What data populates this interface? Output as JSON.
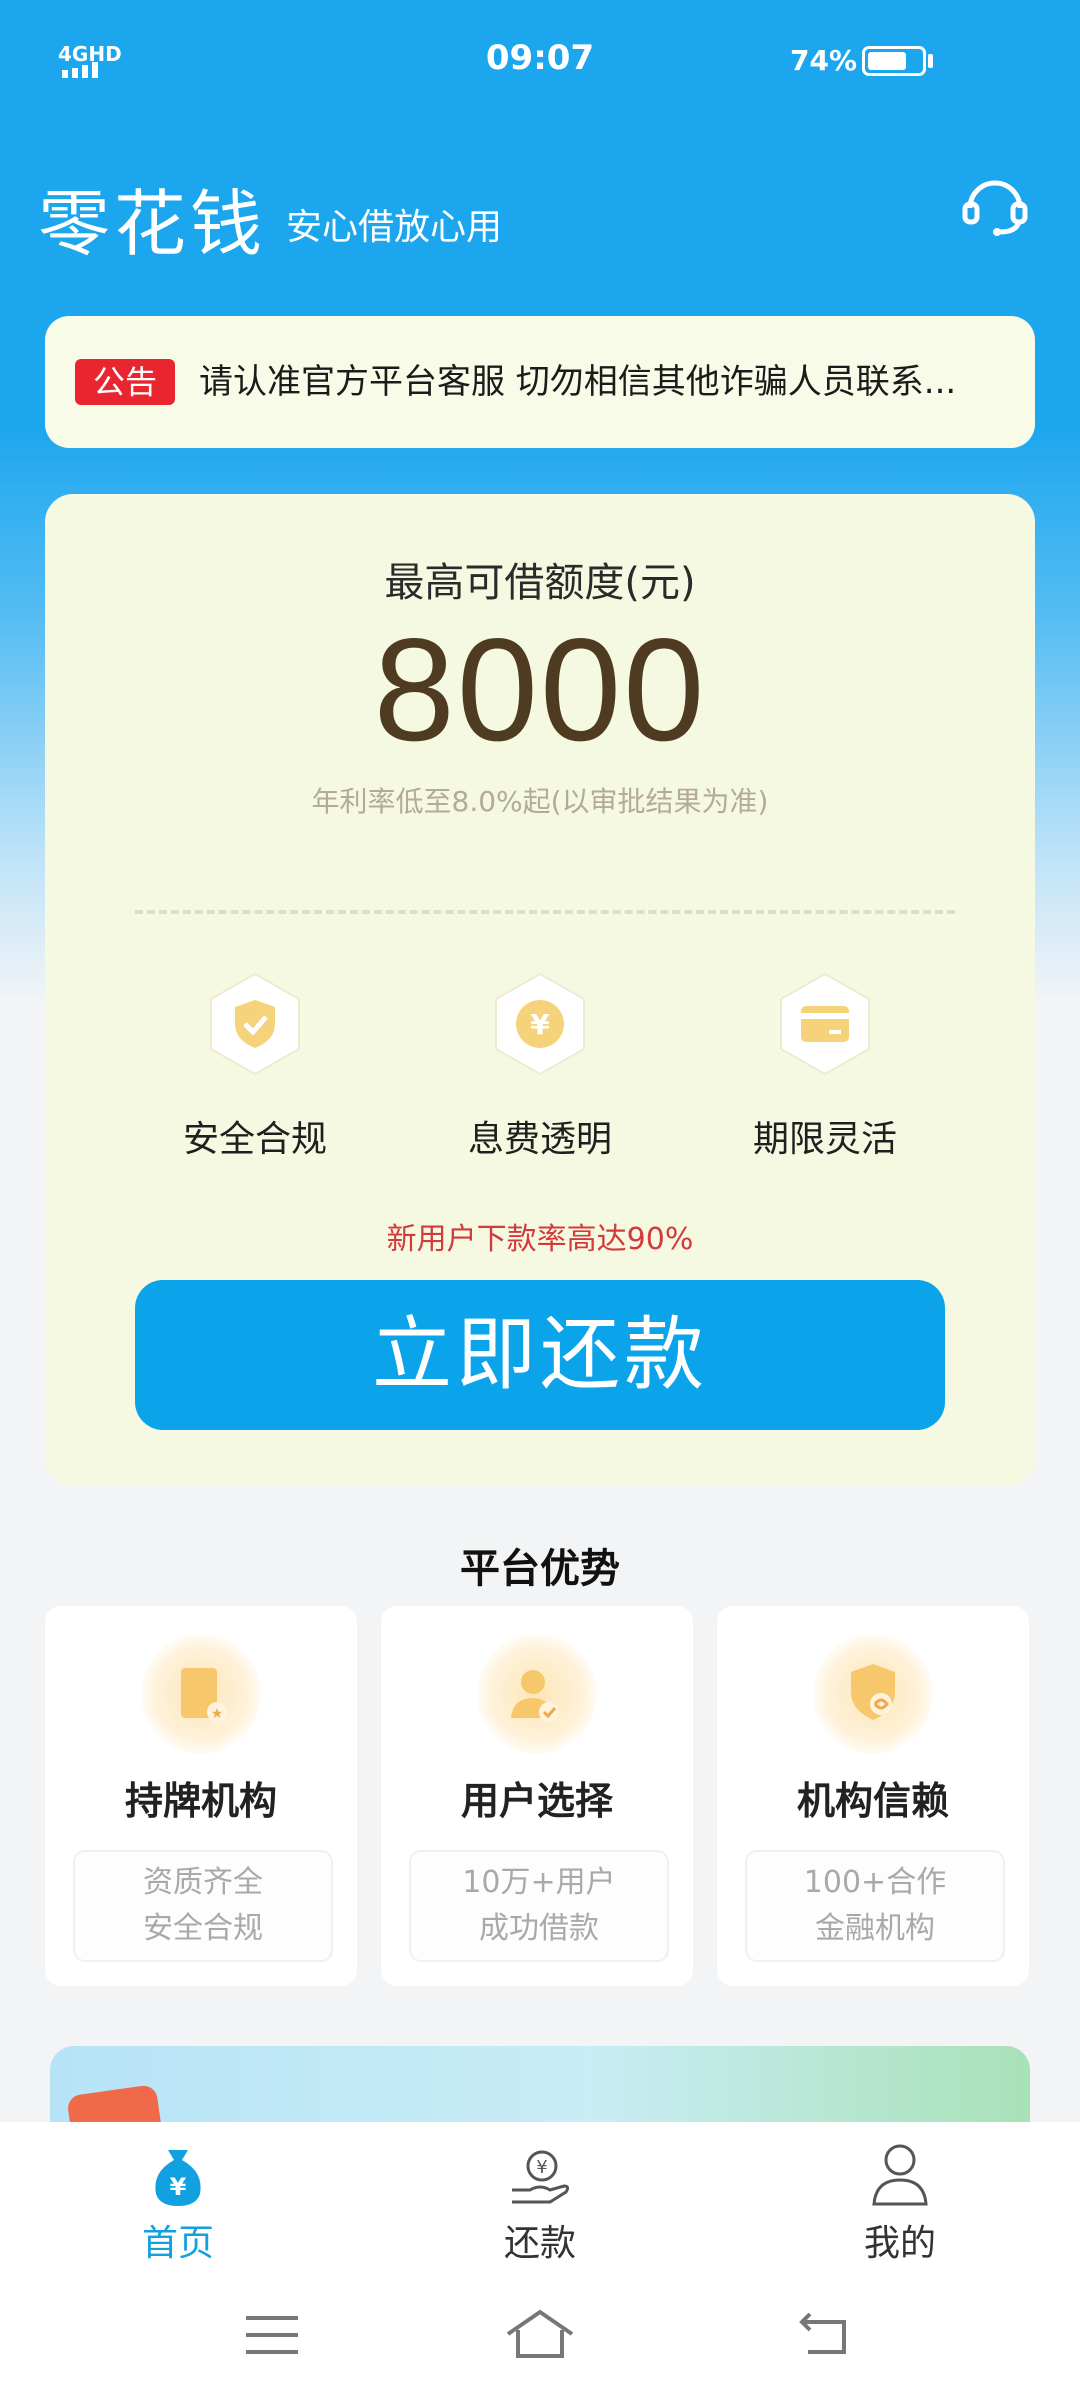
{
  "status_bar": {
    "network": "4GHD",
    "time": "09:07",
    "battery": "74%",
    "battery_level": 0.74
  },
  "header": {
    "brand": "零花钱",
    "slogan": "安心借放心用"
  },
  "notice": {
    "badge": "公告",
    "text": "请认准官方平台客服  切勿相信其他诈骗人员联系..."
  },
  "loan_card": {
    "quota_label": "最高可借额度(元)",
    "quota_value": "8000",
    "rate_note": "年利率低至8.0%起(以审批结果为准)",
    "features": [
      {
        "label": "安全合规",
        "icon": "shield-check-icon"
      },
      {
        "label": "息费透明",
        "icon": "yuan-coin-icon"
      },
      {
        "label": "期限灵活",
        "icon": "card-icon"
      }
    ],
    "promo": "新用户下款率高达90%",
    "button_label": "立即还款"
  },
  "advantages": {
    "title": "平台优势",
    "items": [
      {
        "name": "持牌机构",
        "lines": [
          "资质齐全",
          "安全合规"
        ],
        "icon": "license-icon"
      },
      {
        "name": "用户选择",
        "lines": [
          "10万+用户",
          "成功借款"
        ],
        "icon": "user-check-icon"
      },
      {
        "name": "机构信赖",
        "lines": [
          "100+合作",
          "金融机构"
        ],
        "icon": "shield-handshake-icon"
      }
    ]
  },
  "tabbar": {
    "items": [
      {
        "label": "首页",
        "icon": "money-bag-icon",
        "active": true
      },
      {
        "label": "还款",
        "icon": "repay-hand-icon",
        "active": false
      },
      {
        "label": "我的",
        "icon": "user-icon",
        "active": false
      }
    ]
  },
  "colors": {
    "primary": "#0ba3ea",
    "brown": "#4e3b22",
    "alert": "#e9262f",
    "card_bg": "#f6f9e2"
  }
}
